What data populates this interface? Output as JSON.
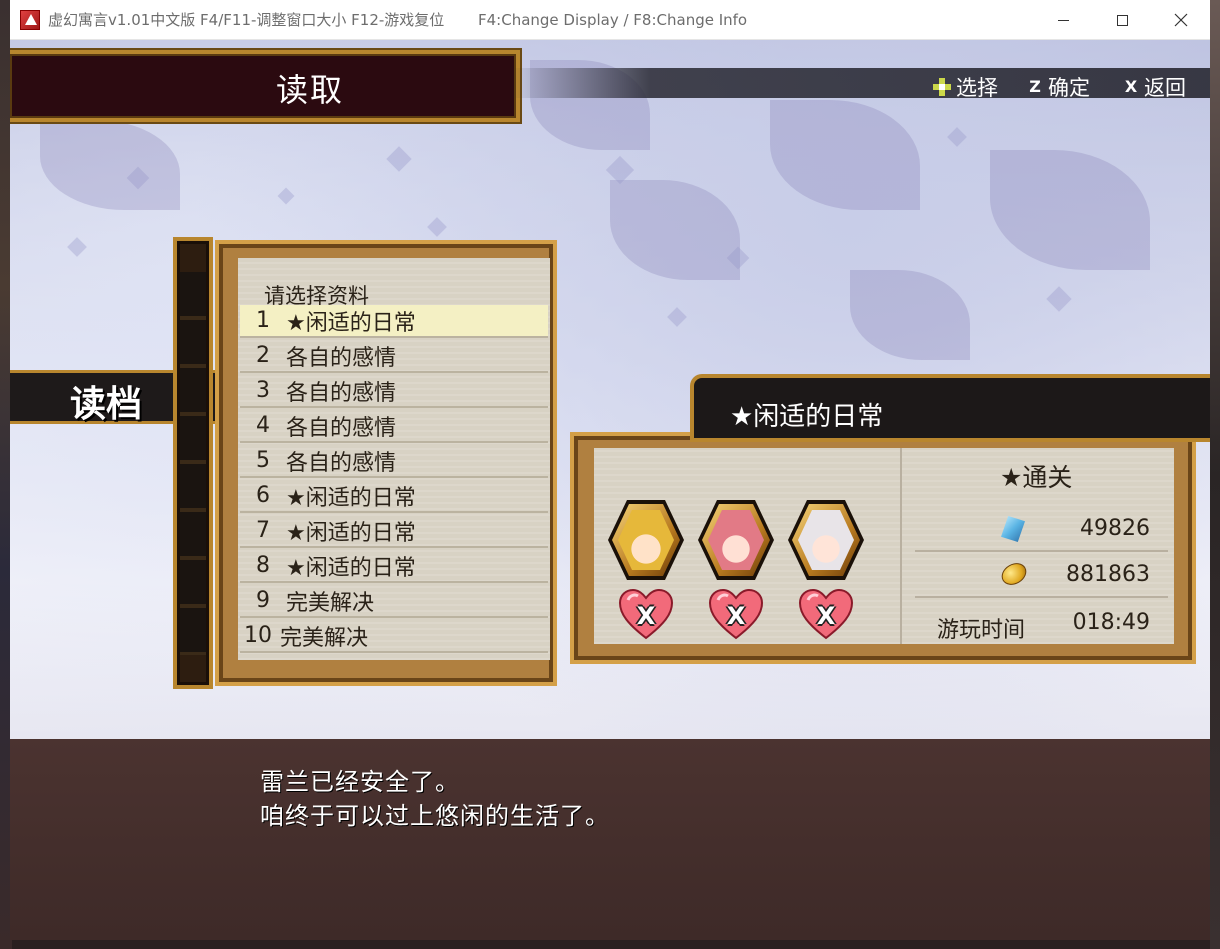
{
  "window": {
    "title": "虚幻寓言v1.01中文版 F4/F11-调整窗口大小 F12-游戏复位",
    "info": "F4:Change Display / F8:Change Info"
  },
  "header": {
    "title": "读取"
  },
  "controls": {
    "select_label": "选择",
    "confirm_key": "Z",
    "confirm_label": "确定",
    "back_key": "X",
    "back_label": "返回"
  },
  "side_banner": {
    "label": "读档"
  },
  "save_list": {
    "header": "请选择资料",
    "selected_index": 0,
    "slots": [
      {
        "num": "1",
        "name": "★闲适的日常"
      },
      {
        "num": "2",
        "name": "各自的感情"
      },
      {
        "num": "3",
        "name": "各自的感情"
      },
      {
        "num": "4",
        "name": "各自的感情"
      },
      {
        "num": "5",
        "name": "各自的感情"
      },
      {
        "num": "6",
        "name": "★闲适的日常"
      },
      {
        "num": "7",
        "name": "★闲适的日常"
      },
      {
        "num": "8",
        "name": "★闲适的日常"
      },
      {
        "num": "9",
        "name": "完美解决"
      },
      {
        "num": "10",
        "name": "完美解决"
      }
    ]
  },
  "detail": {
    "title": "★闲适的日常",
    "status": "★通关",
    "crystals": "49826",
    "gold": "881863",
    "playtime_label": "游玩时间",
    "playtime": "018:49",
    "characters": [
      {
        "portrait": "blonde-character-icon",
        "heart_mark": "X"
      },
      {
        "portrait": "pink-hair-character-icon",
        "heart_mark": "X"
      },
      {
        "portrait": "white-hair-character-icon",
        "heart_mark": "X"
      }
    ]
  },
  "message": {
    "line1": "雷兰已经安全了。",
    "line2": "咱终于可以过上悠闲的生活了。"
  }
}
